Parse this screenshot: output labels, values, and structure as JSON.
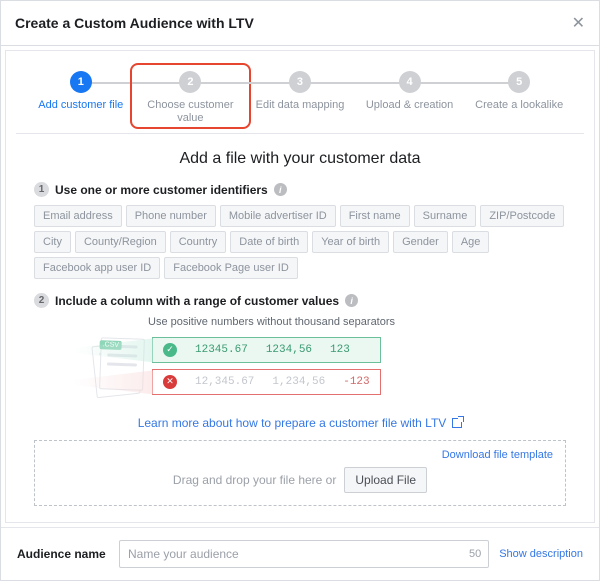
{
  "header": {
    "title": "Create a Custom Audience with LTV"
  },
  "stepper": {
    "steps": [
      {
        "num": "1",
        "label": "Add customer file"
      },
      {
        "num": "2",
        "label": "Choose customer value"
      },
      {
        "num": "3",
        "label": "Edit data mapping"
      },
      {
        "num": "4",
        "label": "Upload & creation"
      },
      {
        "num": "5",
        "label": "Create a lookalike"
      }
    ]
  },
  "main": {
    "title": "Add a file with your customer data",
    "section1": {
      "num": "1",
      "title": "Use one or more customer identifiers"
    },
    "chips": [
      "Email address",
      "Phone number",
      "Mobile advertiser ID",
      "First name",
      "Surname",
      "ZIP/Postcode",
      "City",
      "County/Region",
      "Country",
      "Date of birth",
      "Year of birth",
      "Gender",
      "Age",
      "Facebook app user ID",
      "Facebook Page user ID"
    ],
    "section2": {
      "num": "2",
      "title": "Include a column with a range of customer values"
    },
    "hint": "Use positive numbers without thousand separators",
    "example": {
      "csv_tag": ".CSV",
      "good": [
        "12345.67",
        "1234,56",
        "123"
      ],
      "bad": [
        "12,345.67",
        "1,234,56",
        "-123"
      ]
    },
    "learn_more": "Learn more about how to prepare a customer file with LTV",
    "dropzone": {
      "download": "Download file template",
      "text": "Drag and drop your file here or",
      "button": "Upload File"
    }
  },
  "footer": {
    "label": "Audience name",
    "placeholder": "Name your audience",
    "char_limit": "50",
    "show_desc": "Show description"
  }
}
